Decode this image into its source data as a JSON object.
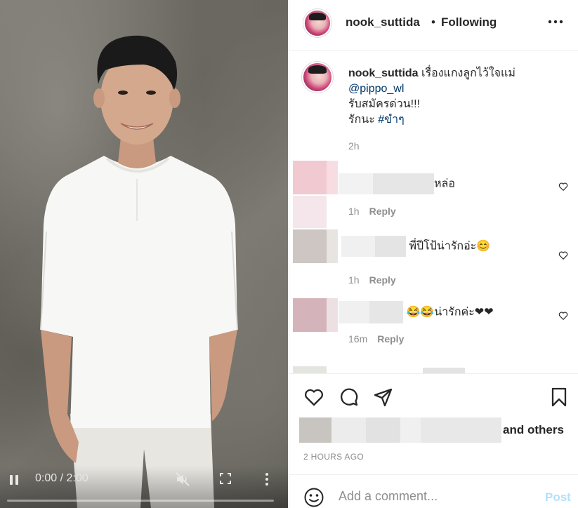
{
  "video": {
    "time": "0:00 / 2:00",
    "progress": 0.0
  },
  "header": {
    "username": "nook_suttida",
    "separator": "•",
    "follow_status": "Following",
    "options_icon": "more-horizontal-icon"
  },
  "caption": {
    "username": "nook_suttida",
    "text_line1": "เรื่องแกงลูกไว้ใจแม่",
    "mention": "@pippo_wl",
    "text_line2": "รับสมัครด่วน!!!",
    "text_line3_prefix": "รักนะ",
    "hashtag": "#ขำๆ",
    "time": "2h"
  },
  "comments": [
    {
      "text": "หล่อ",
      "time": "1h",
      "reply": "Reply"
    },
    {
      "text": "พี่ปีโป้น่ารักอ่ะ😊",
      "time": "1h",
      "reply": "Reply"
    },
    {
      "text": "😂😂น่ารักค่ะ❤❤",
      "time": "16m",
      "reply": "Reply"
    }
  ],
  "likes": {
    "suffix": "and others"
  },
  "timestamp": "2 HOURS AGO",
  "add_comment": {
    "placeholder": "Add a comment...",
    "post_label": "Post"
  },
  "colors": {
    "link": "#00376b",
    "post_disabled": "#b2dffc",
    "secondary_text": "#8e8e8e",
    "heart_red": "#e0245e"
  }
}
